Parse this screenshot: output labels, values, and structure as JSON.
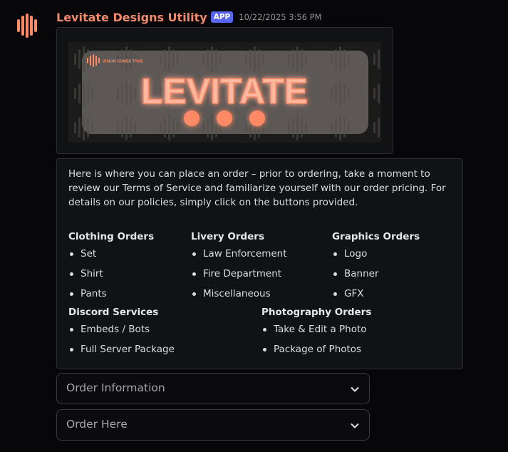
{
  "message": {
    "author": "Levitate Designs Utility",
    "badge": "APP",
    "timestamp": "10/22/2025 3:56 PM",
    "avatar_icon": "orange-bars-logo-icon"
  },
  "banner": {
    "brand_text": "LEVITATE",
    "tagline": "VISION COMES TRUE",
    "accent_color": "#ff8a65",
    "icon": "orange-bars-logo-icon"
  },
  "embed": {
    "intro": "Here is where you can place an order – prior to ordering, take a moment to review our Terms of Service and familiarize yourself with our order pricing. For details on our policies, simply click on the buttons provided.",
    "sections": [
      {
        "title": "Clothing Orders",
        "items": [
          "Set",
          "Shirt",
          "Pants"
        ]
      },
      {
        "title": "Livery Orders",
        "items": [
          "Law Enforcement",
          "Fire Department",
          "Miscellaneous"
        ]
      },
      {
        "title": "Graphics Orders",
        "items": [
          "Logo",
          "Banner",
          "GFX"
        ]
      },
      {
        "title": "Discord Services",
        "items": [
          "Embeds / Bots",
          "Full Server Package"
        ]
      },
      {
        "title": "Photography Orders",
        "items": [
          "Take & Edit a Photo",
          "Package of Photos"
        ]
      }
    ]
  },
  "selects": [
    {
      "placeholder": "Order Information",
      "icon": "chevron-down-icon"
    },
    {
      "placeholder": "Order Here",
      "icon": "chevron-down-icon"
    }
  ],
  "colors": {
    "background": "#070709",
    "username": "#f08a6a",
    "badge": "#5865f2",
    "embed_bg": "#111214"
  }
}
